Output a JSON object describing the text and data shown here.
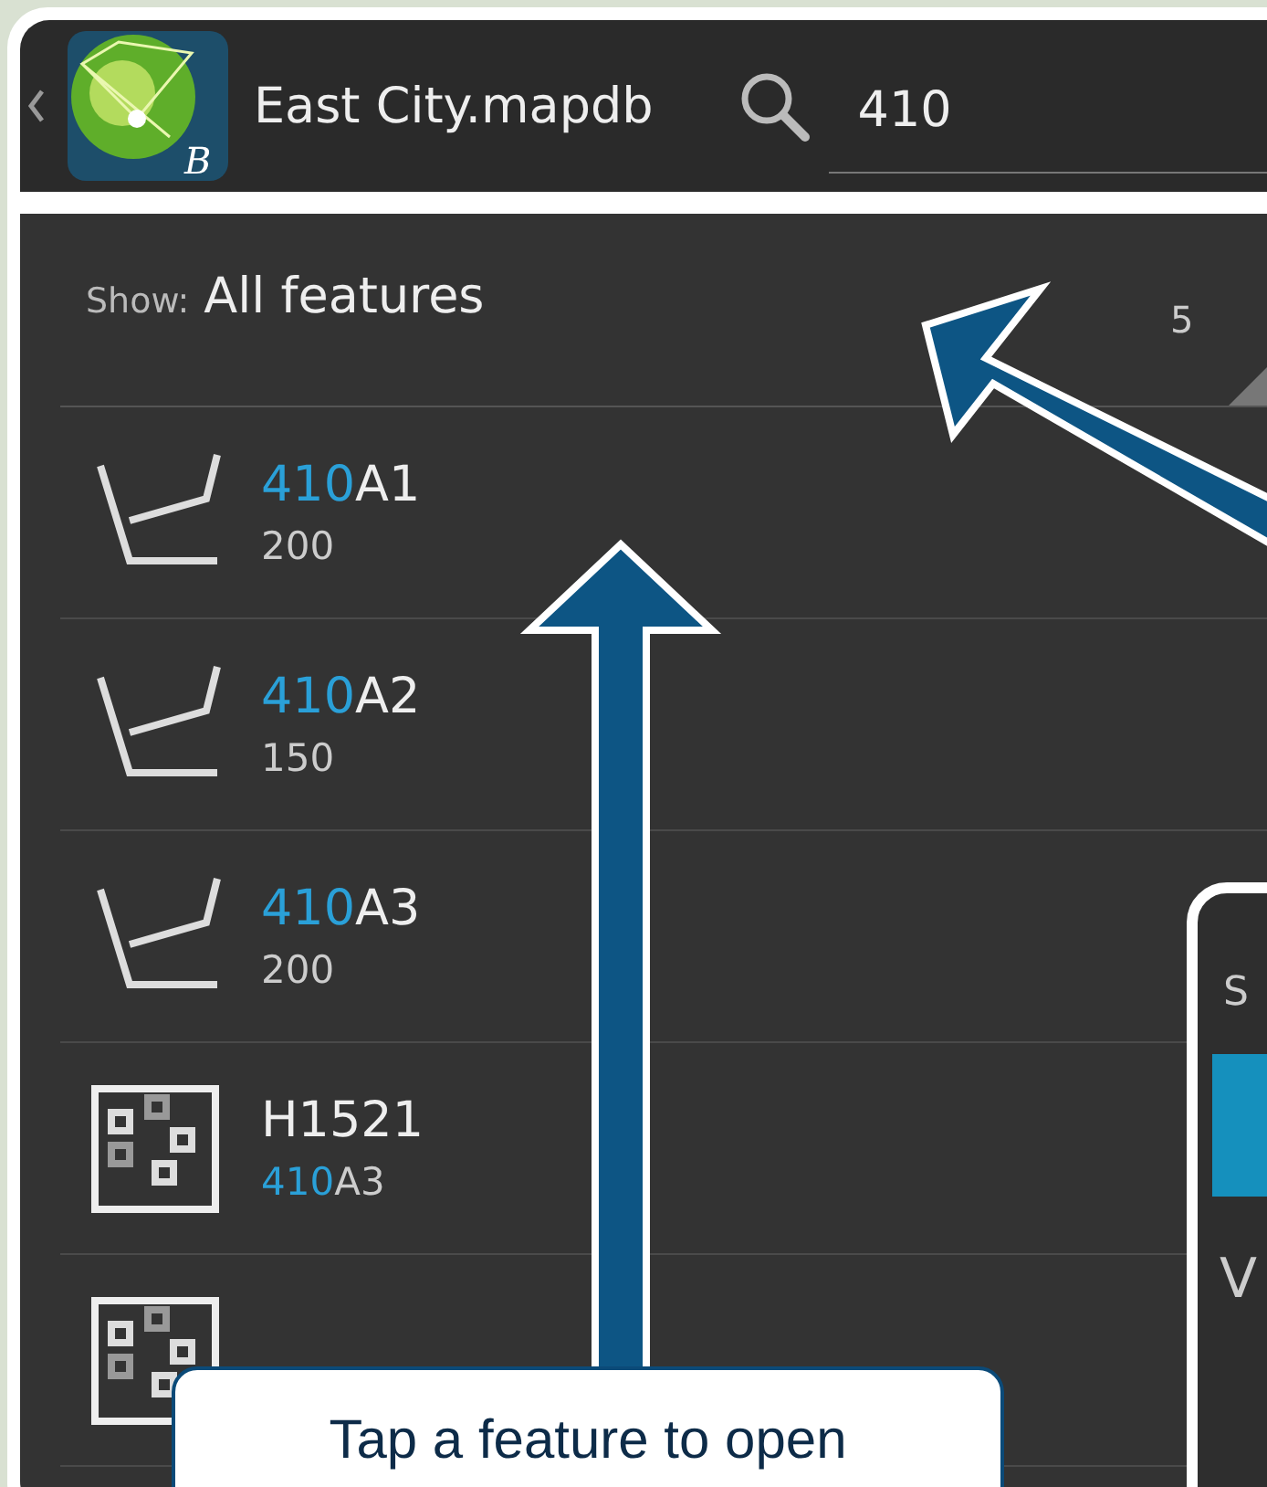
{
  "header": {
    "logo_badge": "B",
    "title": "East City.mapdb",
    "search_value": "410"
  },
  "filter": {
    "label": "Show:",
    "value": "All features",
    "count": "5"
  },
  "features": [
    {
      "kind": "line",
      "title": [
        {
          "text": "410",
          "match": true
        },
        {
          "text": "A1",
          "match": false
        }
      ],
      "subtitle": [
        {
          "text": "200",
          "match": false
        }
      ]
    },
    {
      "kind": "line",
      "title": [
        {
          "text": "410",
          "match": true
        },
        {
          "text": "A2",
          "match": false
        }
      ],
      "subtitle": [
        {
          "text": "150",
          "match": false
        }
      ]
    },
    {
      "kind": "line",
      "title": [
        {
          "text": "410",
          "match": true
        },
        {
          "text": "A3",
          "match": false
        }
      ],
      "subtitle": [
        {
          "text": "200",
          "match": false
        }
      ]
    },
    {
      "kind": "building",
      "title": [
        {
          "text": "H1521",
          "match": false
        }
      ],
      "subtitle": [
        {
          "text": "410",
          "match": true
        },
        {
          "text": "A3",
          "match": false
        }
      ]
    },
    {
      "kind": "building"
    }
  ],
  "second_screen": {
    "top_text": "S",
    "bottom_text": "V"
  },
  "callout": {
    "text": "Tap a feature to open"
  }
}
